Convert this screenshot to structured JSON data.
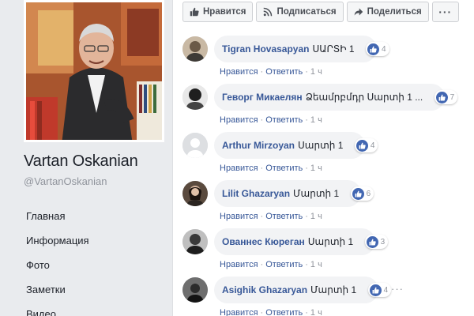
{
  "profile": {
    "name": "Vartan Oskanian",
    "handle": "@VartanOskanian"
  },
  "nav": [
    {
      "label": "Главная"
    },
    {
      "label": "Информация"
    },
    {
      "label": "Фото"
    },
    {
      "label": "Заметки"
    },
    {
      "label": "Видео"
    }
  ],
  "actions": {
    "like": "Нравится",
    "subscribe": "Подписаться",
    "share": "Поделиться",
    "more": "···"
  },
  "comments": [
    {
      "author": "Tigran Hovasapyan",
      "text": "ՍԱՐՏԻ",
      "count": "1",
      "likes": "4",
      "like_label": "Нравится",
      "reply_label": "Ответить",
      "time": "1 ч"
    },
    {
      "author": "Геворг Микаелян",
      "text": "Ձեամրբմդր Սարտի",
      "count": "1 ...",
      "likes": "7",
      "like_label": "Нравится",
      "reply_label": "Ответить",
      "time": "1 ч"
    },
    {
      "author": "Arthur Mirzoyan",
      "text": "Սարտի",
      "count": "1",
      "likes": "4",
      "like_label": "Нравится",
      "reply_label": "Ответить",
      "time": "1 ч"
    },
    {
      "author": "Lilit Ghazaryan",
      "text": "Մարտի",
      "count": "1",
      "likes": "6",
      "like_label": "Нравится",
      "reply_label": "Ответить",
      "time": "1 ч"
    },
    {
      "author": "Ованнес Кюреган",
      "text": "Սարտի",
      "count": "1",
      "likes": "3",
      "like_label": "Нравится",
      "reply_label": "Ответить",
      "time": "1 ч"
    },
    {
      "author": "Asighik Ghazaryan",
      "text": "Մարտի",
      "count": "1",
      "likes": "4",
      "like_label": "Нравится",
      "reply_label": "Ответить",
      "time": "1 ч",
      "more": "···"
    }
  ],
  "colors": {
    "link": "#385898",
    "like_blue": "#4267b2",
    "page_bg": "#e9ebee"
  }
}
